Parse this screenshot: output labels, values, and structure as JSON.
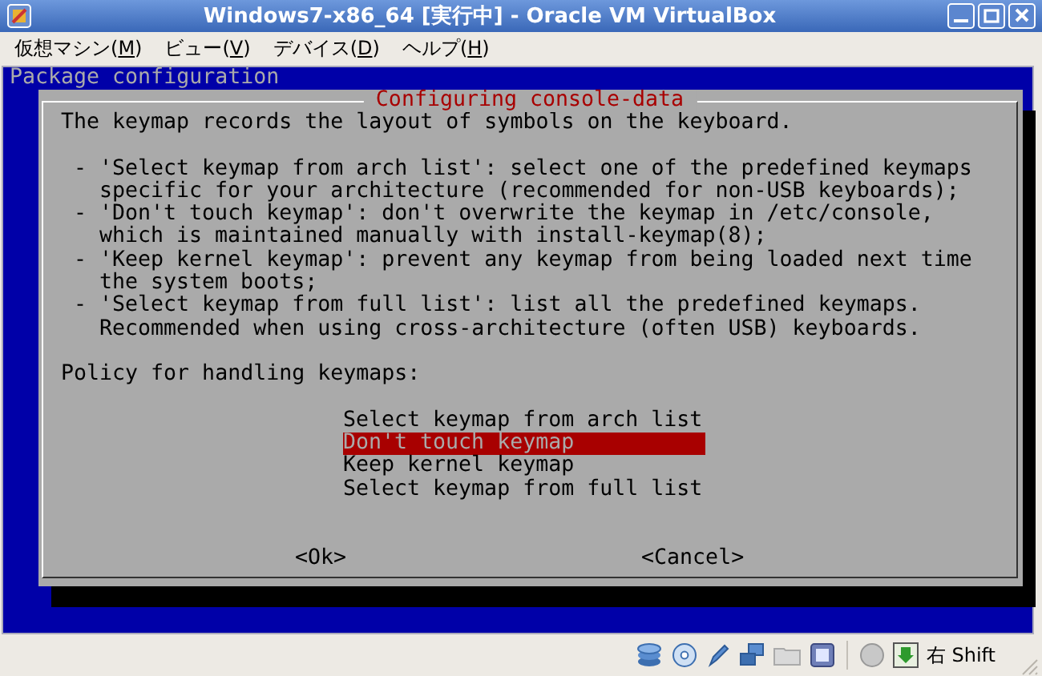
{
  "window": {
    "title": "Windows7-x86_64 [実行中] - Oracle VM VirtualBox"
  },
  "menu": [
    {
      "prefix": "仮想マシン(",
      "mnemonic": "M",
      "suffix": ")"
    },
    {
      "prefix": "ビュー(",
      "mnemonic": "V",
      "suffix": ")"
    },
    {
      "prefix": "デバイス(",
      "mnemonic": "D",
      "suffix": ")"
    },
    {
      "prefix": "ヘルプ(",
      "mnemonic": "H",
      "suffix": ")"
    }
  ],
  "console": {
    "header": "Package configuration",
    "dialog": {
      "title": "Configuring console-data",
      "intro": "The keymap records the layout of symbols on the keyboard.",
      "bullets": [
        {
          "lines": [
            "- 'Select keymap from arch list': select one of the predefined keymaps",
            "specific for your architecture (recommended for non-USB keyboards);"
          ]
        },
        {
          "lines": [
            "- 'Don't touch keymap': don't overwrite the keymap in /etc/console,",
            "which is maintained manually with install-keymap(8);"
          ]
        },
        {
          "lines": [
            "- 'Keep kernel keymap': prevent any keymap from being loaded next time",
            "the system boots;"
          ]
        },
        {
          "lines": [
            "- 'Select keymap from full list': list all the predefined keymaps.",
            "Recommended when using cross-architecture (often USB) keyboards."
          ]
        }
      ],
      "prompt": "Policy for handling keymaps:",
      "options": [
        {
          "label": "Select keymap from arch list",
          "selected": false
        },
        {
          "label": "Don't touch keymap",
          "selected": true
        },
        {
          "label": "Keep kernel keymap",
          "selected": false
        },
        {
          "label": "Select keymap from full list",
          "selected": false
        }
      ],
      "buttons": [
        "<Ok>",
        "<Cancel>"
      ]
    }
  },
  "status_bar": {
    "host_key": "右 Shift"
  }
}
